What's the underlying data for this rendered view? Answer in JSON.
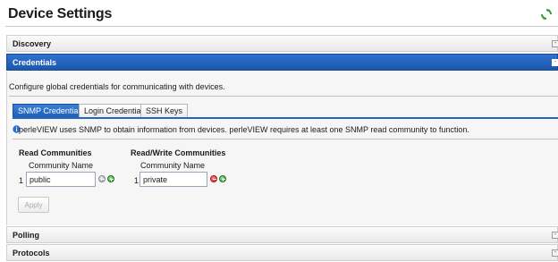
{
  "page": {
    "title": "Device Settings",
    "refresh_icon": "refresh-icon"
  },
  "panels": {
    "discovery": {
      "label": "Discovery",
      "toggle": "-"
    },
    "credentials": {
      "label": "Credentials",
      "toggle": "-"
    },
    "polling": {
      "label": "Polling",
      "toggle": "-"
    },
    "protocols": {
      "label": "Protocols",
      "toggle": "-"
    }
  },
  "credentials": {
    "description": "Configure global credentials for communicating with devices.",
    "tabs": [
      {
        "label": "SNMP Credentials",
        "active": true
      },
      {
        "label": "Login Credentials",
        "active": false
      },
      {
        "label": "SSH Keys",
        "active": false
      }
    ],
    "info_text": "perleVIEW uses SNMP to obtain information from devices. perleVIEW requires at least one SNMP read community to function.",
    "read": {
      "title": "Read Communities",
      "column": "Community Name",
      "rows": [
        {
          "index": "1",
          "value": "public"
        }
      ]
    },
    "read_write": {
      "title": "Read/Write Communities",
      "column": "Community Name",
      "rows": [
        {
          "index": "1",
          "value": "private"
        }
      ]
    },
    "apply_label": "Apply"
  },
  "colors": {
    "accent": "#1c57ad",
    "remove_active": "#d21f1f",
    "add": "#2f9a2f",
    "remove_disabled": "#9b9b9b"
  }
}
